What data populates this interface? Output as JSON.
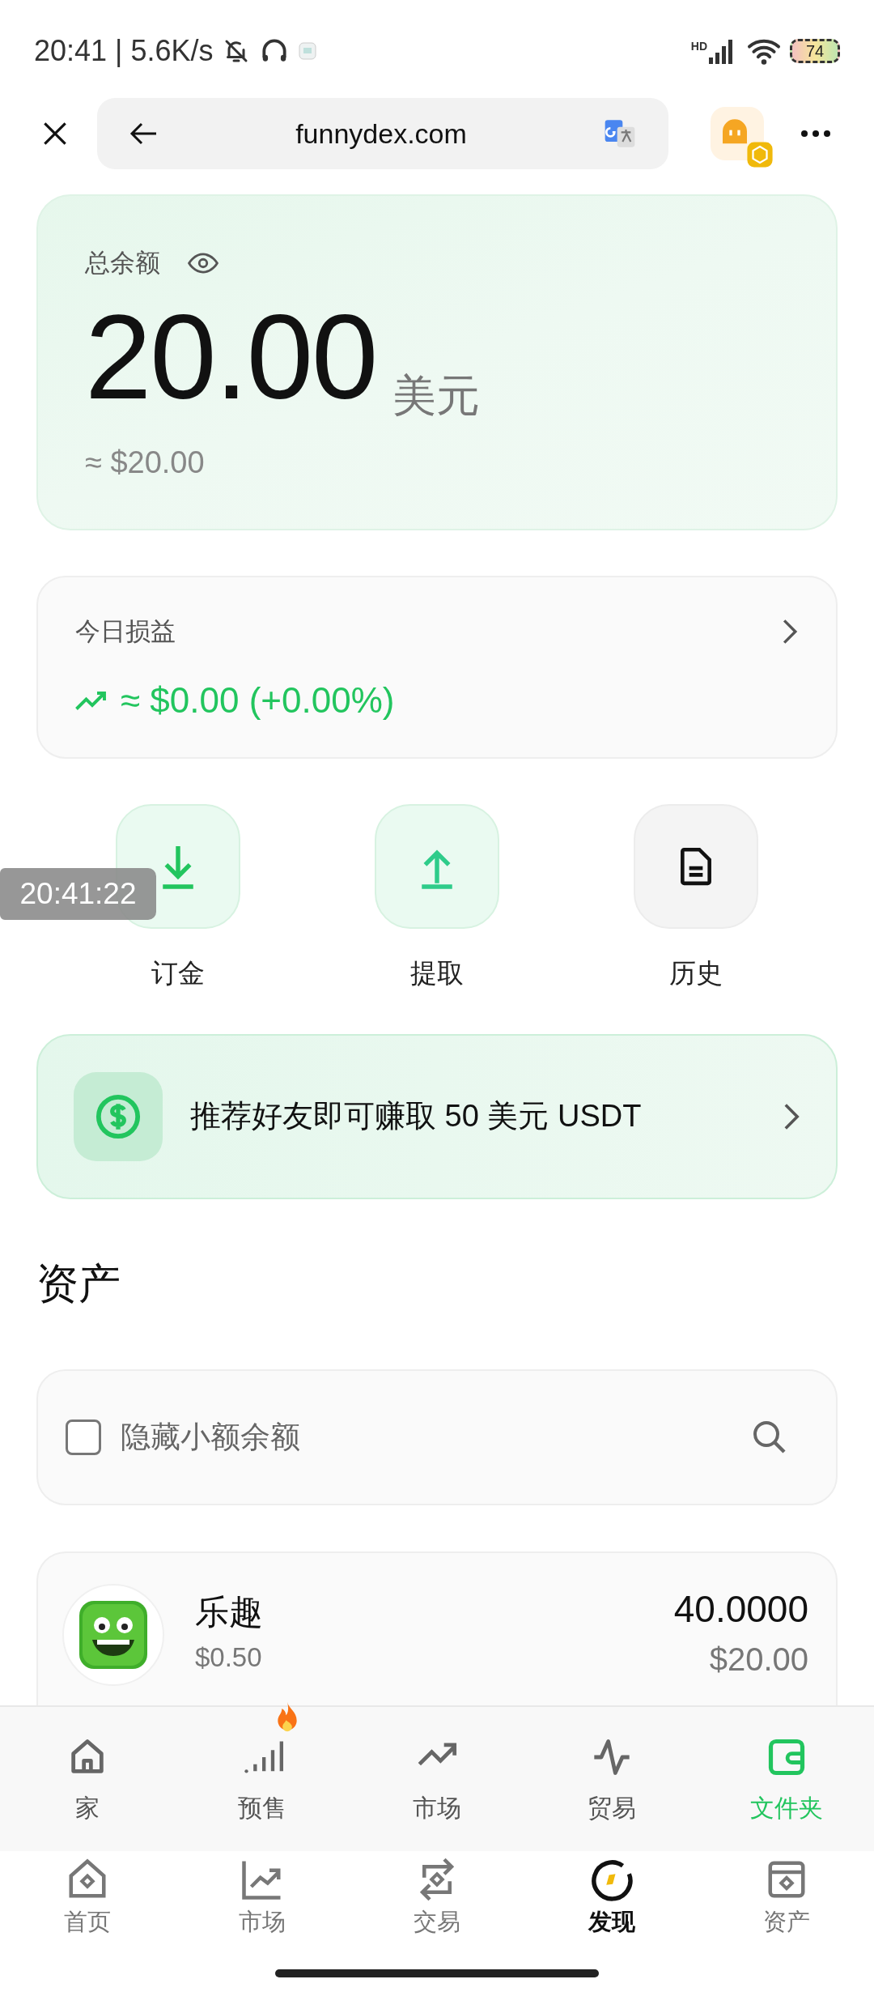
{
  "status_bar": {
    "time": "20:41",
    "speed": "| 5.6K/s",
    "network": "HD",
    "battery": "74"
  },
  "browser": {
    "url": "funnydex.com"
  },
  "balance": {
    "label": "总余额",
    "amount": "20.00",
    "currency": "美元",
    "approx": "≈ $20.00"
  },
  "pnl": {
    "label": "今日损益",
    "value": "≈ $0.00 (+0.00%)"
  },
  "actions": [
    {
      "kind": "deposit",
      "label": "订金"
    },
    {
      "kind": "withdraw",
      "label": "提取"
    },
    {
      "kind": "history",
      "label": "历史"
    }
  ],
  "recording_time": "20:41:22",
  "referral": {
    "text": "推荐好友即可赚取 50 美元 USDT"
  },
  "assets": {
    "title": "资产",
    "hide_small": {
      "label": "隐藏小额余额",
      "checked": false
    },
    "tokens": [
      {
        "name": "乐趣",
        "price": "$0.50",
        "amount": "40.0000",
        "value": "$20.00"
      }
    ]
  },
  "site_nav": [
    {
      "kind": "home",
      "label": "家",
      "selected": false,
      "hot": false
    },
    {
      "kind": "presale",
      "label": "预售",
      "selected": false,
      "hot": true
    },
    {
      "kind": "market",
      "label": "市场",
      "selected": false,
      "hot": false
    },
    {
      "kind": "trade",
      "label": "贸易",
      "selected": false,
      "hot": false
    },
    {
      "kind": "wallet",
      "label": "文件夹",
      "selected": true,
      "hot": false
    }
  ],
  "app_nav": [
    {
      "kind": "home",
      "label": "首页",
      "selected": false
    },
    {
      "kind": "market",
      "label": "市场",
      "selected": false
    },
    {
      "kind": "swap",
      "label": "交易",
      "selected": false
    },
    {
      "kind": "discover",
      "label": "发现",
      "selected": true
    },
    {
      "kind": "assets",
      "label": "资产",
      "selected": false
    }
  ]
}
